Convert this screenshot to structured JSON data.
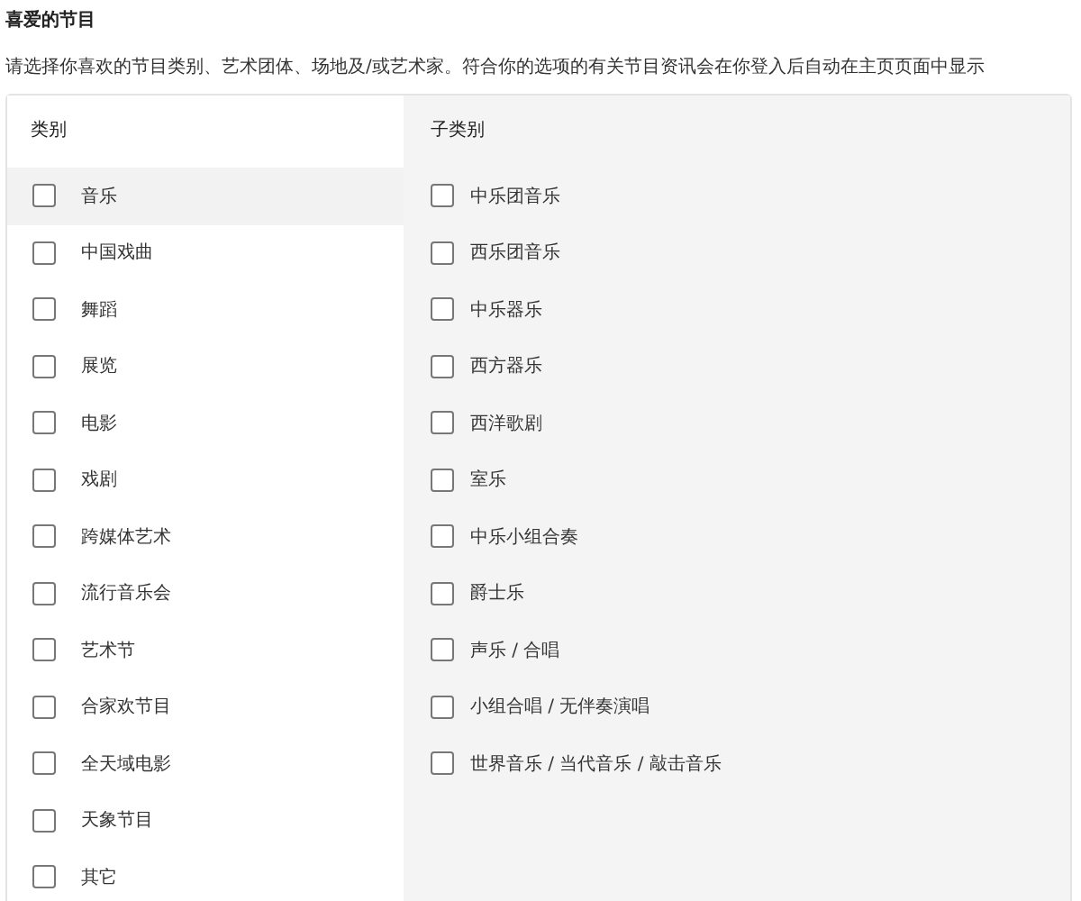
{
  "title": "喜爱的节目",
  "description": "请选择你喜欢的节目类别、艺术团体、场地及/或艺术家。符合你的选项的有关节目资讯会在你登入后自动在主页页面中显示",
  "categories": {
    "heading": "类别",
    "items": [
      {
        "label": "音乐",
        "selected": true,
        "checked": false
      },
      {
        "label": "中国戏曲",
        "selected": false,
        "checked": false
      },
      {
        "label": "舞蹈",
        "selected": false,
        "checked": false
      },
      {
        "label": "展览",
        "selected": false,
        "checked": false
      },
      {
        "label": "电影",
        "selected": false,
        "checked": false
      },
      {
        "label": "戏剧",
        "selected": false,
        "checked": false
      },
      {
        "label": "跨媒体艺术",
        "selected": false,
        "checked": false
      },
      {
        "label": "流行音乐会",
        "selected": false,
        "checked": false
      },
      {
        "label": "艺术节",
        "selected": false,
        "checked": false
      },
      {
        "label": "合家欢节目",
        "selected": false,
        "checked": false
      },
      {
        "label": "全天域电影",
        "selected": false,
        "checked": false
      },
      {
        "label": "天象节目",
        "selected": false,
        "checked": false
      },
      {
        "label": "其它",
        "selected": false,
        "checked": false
      }
    ]
  },
  "subcategories": {
    "heading": "子类别",
    "items": [
      {
        "label": "中乐团音乐",
        "checked": false
      },
      {
        "label": "西乐团音乐",
        "checked": false
      },
      {
        "label": "中乐器乐",
        "checked": false
      },
      {
        "label": "西方器乐",
        "checked": false
      },
      {
        "label": "西洋歌剧",
        "checked": false
      },
      {
        "label": "室乐",
        "checked": false
      },
      {
        "label": "中乐小组合奏",
        "checked": false
      },
      {
        "label": "爵士乐",
        "checked": false
      },
      {
        "label": "声乐 / 合唱",
        "checked": false
      },
      {
        "label": "小组合唱 / 无伴奏演唱",
        "checked": false
      },
      {
        "label": "世界音乐 / 当代音乐 / 敲击音乐",
        "checked": false
      }
    ]
  }
}
